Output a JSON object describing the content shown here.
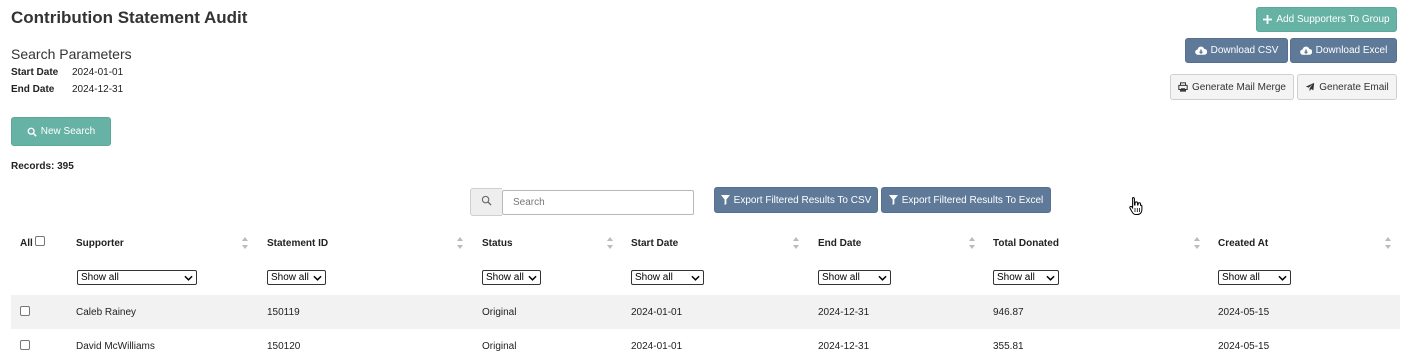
{
  "page": {
    "title": "Contribution Statement Audit"
  },
  "params": {
    "heading": "Search Parameters",
    "start_label": "Start Date",
    "start_value": "2024-01-01",
    "end_label": "End Date",
    "end_value": "2024-12-31"
  },
  "actions": {
    "add_supporters": "Add Supporters To Group",
    "download_csv": "Download CSV",
    "download_excel": "Download Excel",
    "mail_merge": "Generate Mail Merge",
    "email": "Generate Email",
    "new_search": "New Search"
  },
  "records": "Records: 395",
  "search": {
    "placeholder": "Search"
  },
  "export": {
    "csv": "Export Filtered Results To CSV",
    "excel": "Export Filtered Results To Excel"
  },
  "table": {
    "all_label": "All",
    "columns": [
      "Supporter",
      "Statement ID",
      "Status",
      "Start Date",
      "End Date",
      "Total Donated",
      "Created At"
    ],
    "filter_label": "Show all",
    "rows": [
      [
        "Caleb Rainey",
        "150119",
        "Original",
        "2024-01-01",
        "2024-12-31",
        "946.87",
        "2024-05-15"
      ],
      [
        "David McWilliams",
        "150120",
        "Original",
        "2024-01-01",
        "2024-12-31",
        "355.81",
        "2024-05-15"
      ]
    ]
  },
  "icons": {
    "plus": "plus-icon",
    "cloud_download": "cloud-download-icon",
    "printer": "printer-icon",
    "paper_plane": "paper-plane-icon",
    "search": "search-icon",
    "filter": "filter-icon",
    "sort": "sort-icon",
    "cursor": "hand-cursor-icon"
  },
  "colors": {
    "teal": "#66b2a5",
    "slate": "#5f7a99",
    "row_alt": "#f2f2f2"
  }
}
